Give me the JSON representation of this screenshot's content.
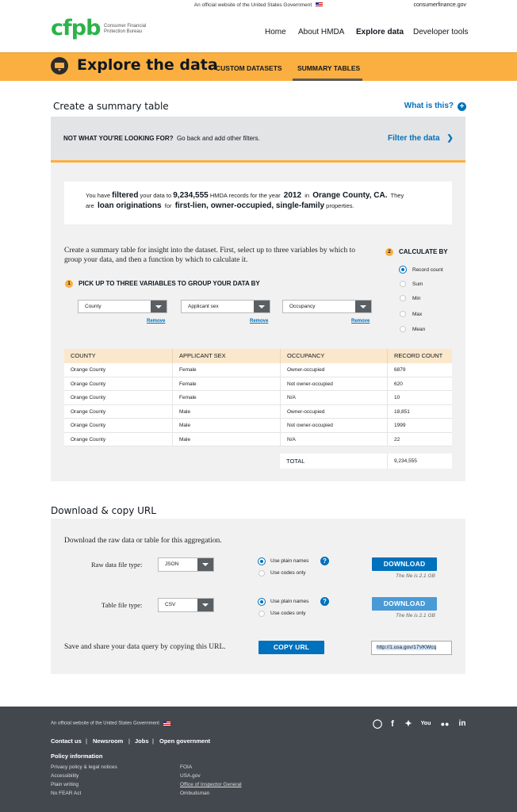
{
  "topbar": {
    "official": "An official website of the United States Government",
    "site": "consumerfinance.gov"
  },
  "logo": {
    "mark": "cfpb",
    "line1": "Consumer Financial",
    "line2": "Protection Bureau"
  },
  "nav": [
    "Home",
    "About HMDA",
    "Explore data",
    "Developer tools"
  ],
  "banner": {
    "title": "Explore the data",
    "tabs": [
      "CUSTOM DATASETS",
      "SUMMARY TABLES"
    ]
  },
  "section1": {
    "title": "Create a summary table",
    "whatis": "What is this?"
  },
  "notfound": {
    "bold": "NOT WHAT YOU'RE LOOKING FOR?",
    "text": "Go back and add other filters.",
    "link": "Filter the data"
  },
  "summary": {
    "p1": "You have",
    "filtered": "filtered",
    "p2": "your data to",
    "count": "9,234,555",
    "p3": "HMDA records for the year",
    "year": "2012",
    "p4": "in",
    "county": "Orange County, CA.",
    "p5": "They",
    "p6": "are",
    "type": "loan originations",
    "p7": "for",
    "lien": "first-lien, owner-occupied, single-family",
    "p8": "properties."
  },
  "description": "Create a summary table for insight into the dataset. First, select up to three variables by which to group your data, and then a function by which to calculate it.",
  "step1": {
    "num": "1",
    "label": "PICK UP TO THREE VARIABLES TO GROUP YOUR DATA BY"
  },
  "step2": {
    "num": "2",
    "label": "CALCULATE BY"
  },
  "calc_options": [
    "Record count",
    "Sum",
    "Min",
    "Max",
    "Mean"
  ],
  "calc_selected": 0,
  "selects": [
    "County",
    "Applicant sex",
    "Occupancy"
  ],
  "remove_label": "Remove",
  "table": {
    "headers": [
      "COUNTY",
      "APPLICANT SEX",
      "OCCUPANCY",
      "RECORD COUNT"
    ],
    "rows": [
      [
        "Orange County",
        "Female",
        "Owner-occupied",
        "6879"
      ],
      [
        "Orange County",
        "Female",
        "Not owner-occupied",
        "620"
      ],
      [
        "Orange County",
        "Female",
        "N/A",
        "10"
      ],
      [
        "Orange County",
        "Male",
        "Owner-occupied",
        "18,851"
      ],
      [
        "Orange County",
        "Male",
        "Not owner-occupied",
        "1999"
      ],
      [
        "Orange County",
        "Male",
        "N/A",
        "22"
      ]
    ],
    "total_label": "TOTAL",
    "total_value": "9,234,555"
  },
  "section2": {
    "title": "Download & copy URL",
    "intro": "Download the raw data or table for this aggregation."
  },
  "raw": {
    "label": "Raw data file type:",
    "value": "JSON",
    "opt1": "Use plain names",
    "opt2": "Use codes only",
    "button": "DOWNLOAD",
    "size": "The file is 2.1 GB"
  },
  "tablefile": {
    "label": "Table file type:",
    "value": "CSV",
    "opt1": "Use plain names",
    "opt2": "Use codes only",
    "button": "DOWNLOAD",
    "size": "The file is 2.1 GB"
  },
  "share": {
    "text": "Save and share your data query by copying this URL.",
    "button": "COPY URL",
    "url": "http://1.usa.gov/17VKWcq"
  },
  "footer": {
    "official": "An official website of the United States Government",
    "links": [
      "Contact us",
      "Newsroom",
      "Jobs",
      "Open government"
    ],
    "policy_title": "Policy information",
    "col1": [
      "Privacy policy & legal notices",
      "Accessibility",
      "Plain writing",
      "No FEAR Act"
    ],
    "col2": [
      "FOIA",
      "USA.gov",
      "Office of Inspector General",
      "Ombudsman"
    ]
  },
  "social_icons": [
    "github-icon",
    "facebook-icon",
    "twitter-icon",
    "youtube-icon",
    "flickr-icon",
    "linkedin-icon"
  ],
  "colors": {
    "accent": "#fcaf41",
    "link": "#0071bc",
    "green": "#2cb34a",
    "footer": "#43484e"
  }
}
